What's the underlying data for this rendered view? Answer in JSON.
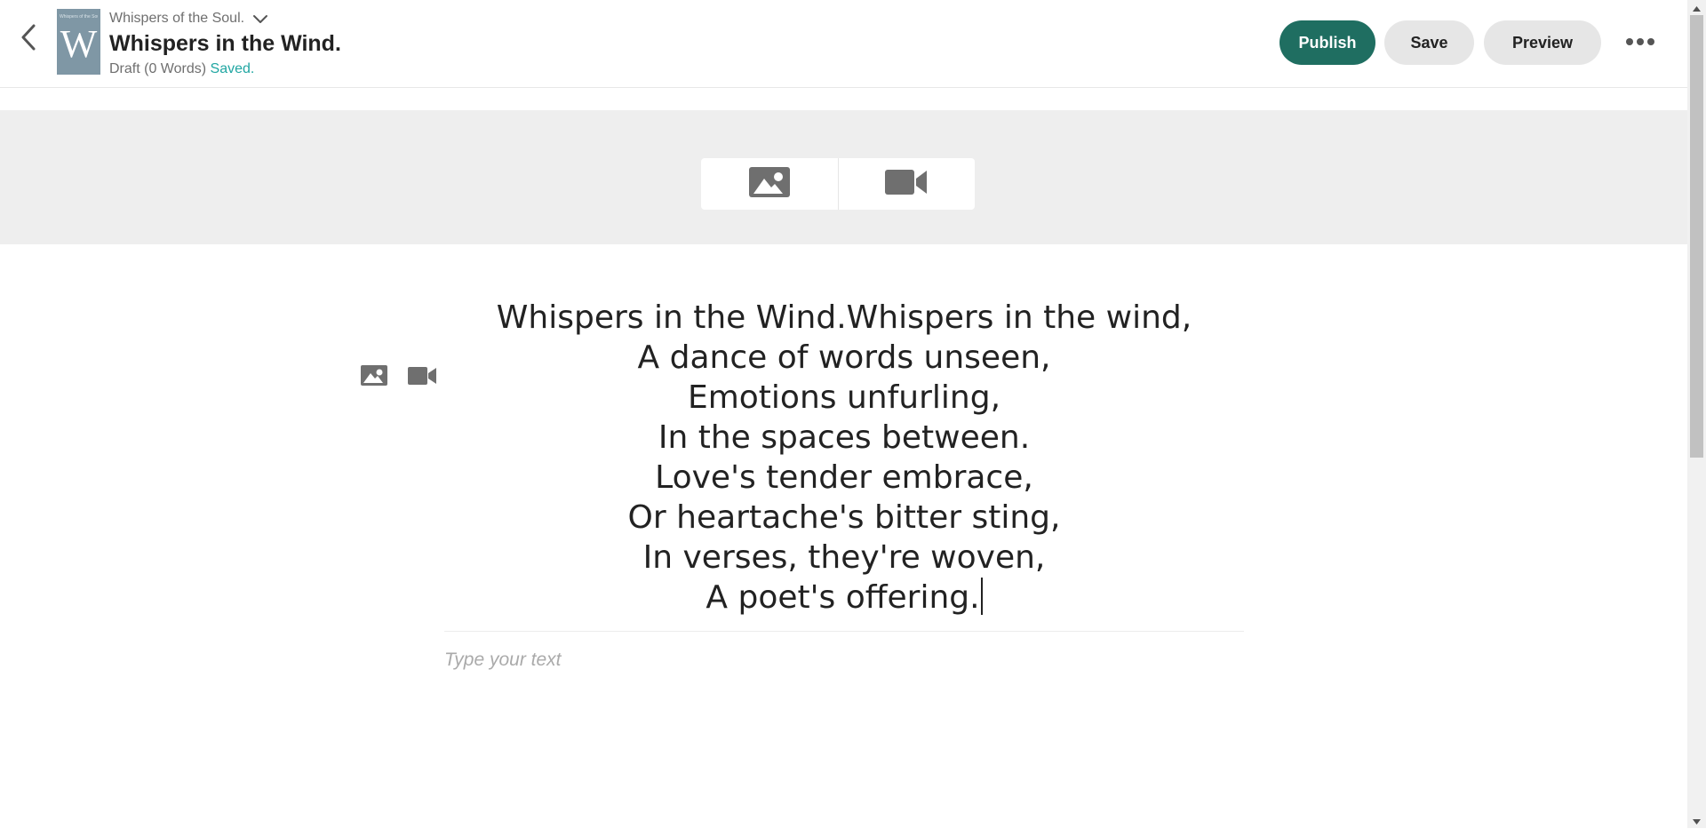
{
  "header": {
    "cover": {
      "letter": "W",
      "tiny_text": "Whispers of the Soul.",
      "color": "#7f97a5"
    },
    "parent_story": "Whispers of the Soul.",
    "part_title": "Whispers in the Wind.",
    "status": {
      "draft_text": "Draft (0 Words)",
      "saved_text": "Saved."
    },
    "buttons": {
      "publish": "Publish",
      "save": "Save",
      "preview": "Preview"
    },
    "icons": {
      "back": "chevron-left-icon",
      "parent_dropdown": "chevron-down-icon",
      "more": "more-horizontal-icon"
    }
  },
  "media_band": {
    "options": [
      "image-icon",
      "video-camera-icon"
    ]
  },
  "editor": {
    "side_tools": [
      "image-icon",
      "video-camera-icon"
    ],
    "poem_lines": [
      "Whispers in the Wind.Whispers in the wind,",
      "A dance of words unseen,",
      "Emotions unfurling,",
      "In the spaces between.",
      "Love's tender embrace,",
      "Or heartache's bitter sting,",
      "In verses, they're woven,",
      "A poet's offering."
    ],
    "next_paragraph": {
      "value": "",
      "placeholder": "Type your text"
    }
  },
  "colors": {
    "publish": "#1f6e61",
    "saved": "#20a6a2",
    "secondary_button": "#e6e6e6",
    "media_band": "#eeeeee",
    "icon": "#6f6f6f"
  }
}
